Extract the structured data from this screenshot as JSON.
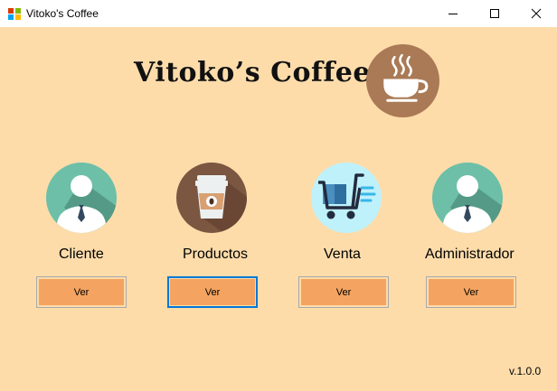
{
  "window": {
    "title": "Vitoko's Coffee",
    "controls": [
      "minimize",
      "maximize",
      "close"
    ]
  },
  "header": {
    "title": "Vitoko’s Coffee",
    "logo_icon": "coffee-cup-icon"
  },
  "modules": [
    {
      "label": "Cliente",
      "button_label": "Ver",
      "icon": "user-icon"
    },
    {
      "label": "Productos",
      "button_label": "Ver",
      "icon": "coffee-takeaway-icon"
    },
    {
      "label": "Venta",
      "button_label": "Ver",
      "icon": "shopping-cart-icon"
    },
    {
      "label": "Administrador",
      "button_label": "Ver",
      "icon": "admin-user-icon"
    }
  ],
  "footer": {
    "version": "v.1.0.0"
  },
  "colors": {
    "background": "#fddcaa",
    "button": "#f4a460",
    "logo_circle": "#a97a55",
    "user_circle": "#6dbfa7",
    "product_circle": "#7b5640",
    "cart_circle": "#bff1fb",
    "focus_border": "#0078d7"
  }
}
